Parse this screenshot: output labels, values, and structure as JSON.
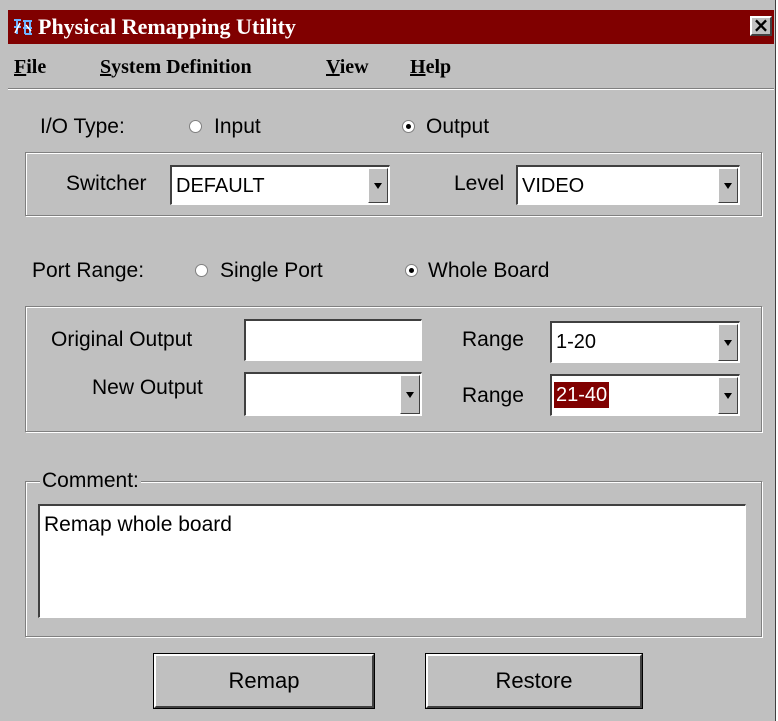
{
  "window": {
    "title": "Physical Remapping Utility",
    "title_bar_color": "#800000",
    "close_label": "×"
  },
  "menu": {
    "file": {
      "mnemonic": "F",
      "rest": "ile"
    },
    "system_definition": {
      "mnemonic": "S",
      "rest": "ystem Definition"
    },
    "view": {
      "mnemonic": "V",
      "rest": "iew"
    },
    "help": {
      "mnemonic": "H",
      "rest": "elp"
    }
  },
  "io_type": {
    "label": "I/O Type:",
    "options": {
      "input": "Input",
      "output": "Output"
    },
    "selected": "Output"
  },
  "switcher": {
    "label": "Switcher",
    "value": "DEFAULT"
  },
  "level": {
    "label": "Level",
    "value": "VIDEO"
  },
  "port_range": {
    "label": "Port Range:",
    "options": {
      "single": "Single Port",
      "whole": "Whole Board"
    },
    "selected": "Whole Board"
  },
  "original_output": {
    "label": "Original Output",
    "value": "",
    "range_label": "Range",
    "range_value": "1-20"
  },
  "new_output": {
    "label": "New Output",
    "value": "",
    "range_label": "Range",
    "range_value": "21-40"
  },
  "comment": {
    "label": "Comment:",
    "value": "Remap whole board"
  },
  "buttons": {
    "remap": "Remap",
    "restore": "Restore"
  },
  "colors": {
    "face": "#c0c0c0",
    "selection": "#800000"
  }
}
